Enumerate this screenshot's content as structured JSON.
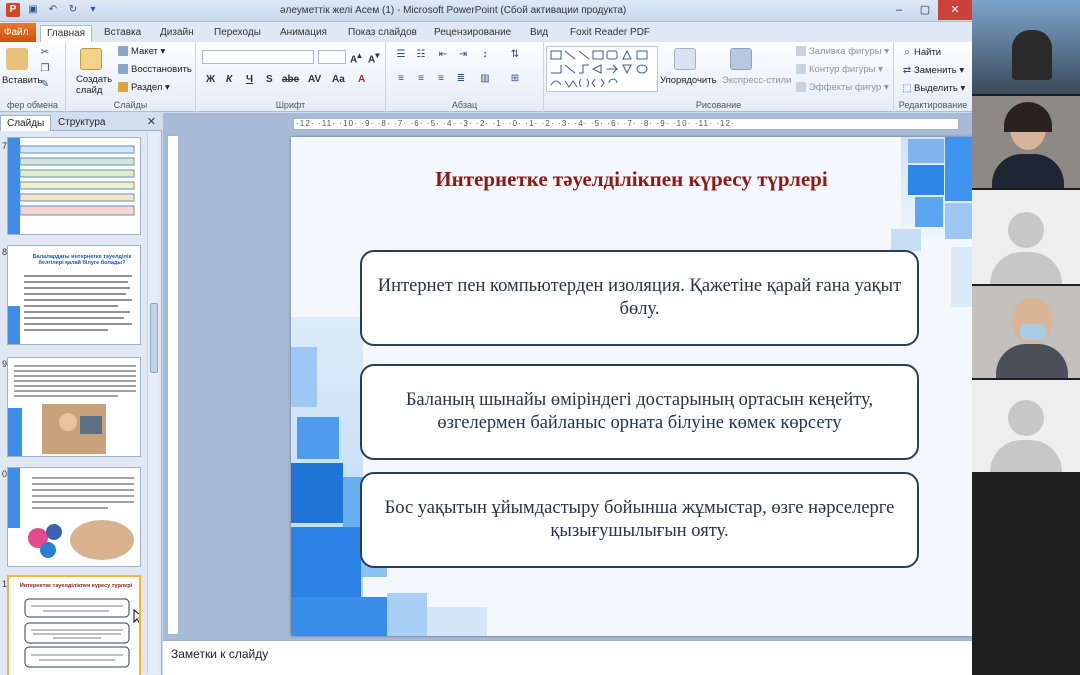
{
  "window": {
    "title": "әлеуметтік желі Асем (1)  -  Microsoft PowerPoint (Сбой активации продукта)"
  },
  "tabs": [
    {
      "label": "Файл"
    },
    {
      "label": "Главная"
    },
    {
      "label": "Вставка"
    },
    {
      "label": "Дизайн"
    },
    {
      "label": "Переходы"
    },
    {
      "label": "Анимация"
    },
    {
      "label": "Показ слайдов"
    },
    {
      "label": "Рецензирование"
    },
    {
      "label": "Вид"
    },
    {
      "label": "Foxit Reader PDF"
    }
  ],
  "ribbon": {
    "clipboard": {
      "paste": "Вставить",
      "label": "фер обмена"
    },
    "slides": {
      "new_slide": "Создать слайд",
      "layout": "Макет",
      "reset": "Восстановить",
      "section": "Раздел",
      "label": "Слайды"
    },
    "font": {
      "label": "Шрифт",
      "bold": "Ж",
      "italic": "К",
      "underline": "Ч",
      "strike": "S",
      "shadow": "abe",
      "spacing": "AV",
      "case": "Aa",
      "color": "A"
    },
    "paragraph": {
      "label": "Абзац"
    },
    "drawing": {
      "arrange": "Упорядочить",
      "quick_styles": "Экспресс-стили",
      "fill": "Заливка фигуры",
      "outline": "Контур фигуры",
      "effects": "Эффекты фигур",
      "label": "Рисование"
    },
    "editing": {
      "find": "Найти",
      "replace": "Заменить",
      "select": "Выделить",
      "label": "Редактирование"
    }
  },
  "panel": {
    "tab_slides": "Слайды",
    "tab_outline": "Структура",
    "slide_numbers": [
      "7",
      "8",
      "9",
      "0",
      "1"
    ],
    "thumb_titles": [
      "Балалардағы интернетке тәуелділік белгілері қалай білуге болады?",
      "Интернетке тәуелділікпен күресу түрлері"
    ]
  },
  "slide": {
    "title": "Интернетке тәуелділікпен күресу түрлері",
    "boxes": [
      "Интернет  пен компьютерден изоляция. Қажетіне қарай ғана уақыт бөлу.",
      "Баланың шынайы өміріндегі достарының ортасын кеңейту, өзгелермен байланыс орната білуіне көмек көрсету",
      "Бос уақытын ұйымдастыру бойынша жұмыстар, өзге нәрселерге  қызығушылығын ояту."
    ]
  },
  "notes": {
    "placeholder": "Заметки к слайду"
  },
  "ruler": {
    "labels": "·12· ·11· ·10· ·9· ·8· ·7· ·6· ·5· ·4· ·3· ·2· ·1· ·0· ·1· ·2· ·3· ·4· ·5· ·6· ·7· ·8· ·9· ·10· ·11· ·12·"
  },
  "colors": {
    "accent": "#d24726",
    "title": "#8b1a17",
    "box_border": "#2b3f5c",
    "slide_blue": "#1f74d6"
  }
}
